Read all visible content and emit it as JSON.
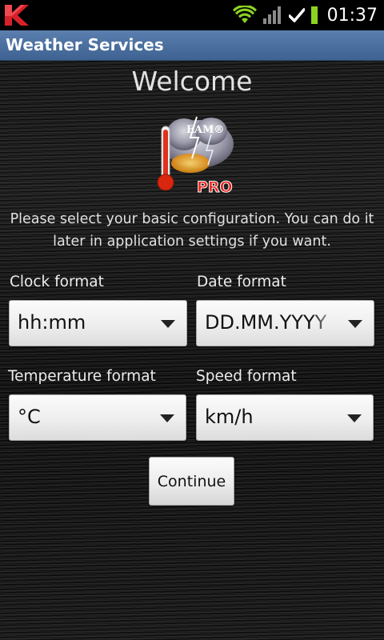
{
  "status_bar": {
    "time": "01:37",
    "icons": [
      "kaspersky-logo",
      "wifi-icon",
      "signal-icon",
      "check-icon",
      "battery-icon"
    ]
  },
  "title_bar": {
    "title": "Weather Services"
  },
  "welcome": {
    "heading": "Welcome"
  },
  "app_icon": {
    "badge_top": "EAM®",
    "badge_bottom": "PRO"
  },
  "intro": {
    "text": "Please select your basic configuration. You can do it later in application settings if you want."
  },
  "form": {
    "clock_format": {
      "label": "Clock format",
      "value": "hh:mm"
    },
    "date_format": {
      "label": "Date format",
      "value": "DD.MM.YYYY"
    },
    "temperature_format": {
      "label": "Temperature format",
      "value": "°C"
    },
    "speed_format": {
      "label": "Speed format",
      "value": "km/h"
    }
  },
  "actions": {
    "continue_label": "Continue"
  },
  "colors": {
    "titlebar": "#4a6f9f",
    "accent_green": "#8cd321",
    "kaspersky_red": "#d7212a"
  }
}
